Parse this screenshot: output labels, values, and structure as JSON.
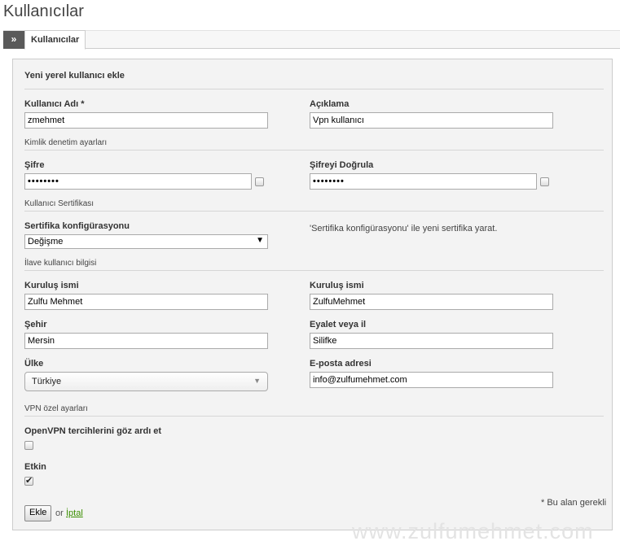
{
  "page": {
    "title": "Kullanıcılar"
  },
  "tabs": {
    "toggle": "»",
    "active_label": "Kullanıcılar"
  },
  "form": {
    "section_title": "Yeni yerel kullanıcı ekle",
    "username_label": "Kullanıcı Adı *",
    "username_value": "zmehmet",
    "description_label": "Açıklama",
    "description_value": "Vpn kullanıcı",
    "auth_section": "Kimlik denetim ayarları",
    "password_label": "Şifre",
    "password_value": "••••••••",
    "confirm_label": "Şifreyi Doğrula",
    "confirm_value": "••••••••",
    "cert_section": "Kullanıcı Sertifikası",
    "cert_config_label": "Sertifika konfigürasyonu",
    "cert_config_value": "Değişme",
    "cert_note": "'Sertifika konfigürasyonu' ile yeni sertifika yarat.",
    "extra_section": "İlave kullanıcı bilgisi",
    "org_label_1": "Kuruluş ismi",
    "org_value_1": "Zulfu Mehmet",
    "org_label_2": "Kuruluş ismi",
    "org_value_2": "ZulfuMehmet",
    "city_label": "Şehir",
    "city_value": "Mersin",
    "state_label": "Eyalet veya il",
    "state_value": "Silifke",
    "country_label": "Ülke",
    "country_value": "Türkiye",
    "email_label": "E-posta adresi",
    "email_value": "info@zulfumehmet.com",
    "vpn_section": "VPN özel ayarları",
    "openvpn_label": "OpenVPN tercihlerini göz ardı et",
    "openvpn_checked": false,
    "enabled_label": "Etkin",
    "enabled_checked": true,
    "add_button": "Ekle",
    "or_text": "or",
    "cancel_link": "İptal",
    "required_note": "* Bu alan gerekli"
  },
  "watermark": "www.zulfumehmet.com",
  "colors": {
    "link": "#3a8e00",
    "tab_toggle": "#5a5a5a",
    "panel_bg": "#f3f3f3"
  }
}
